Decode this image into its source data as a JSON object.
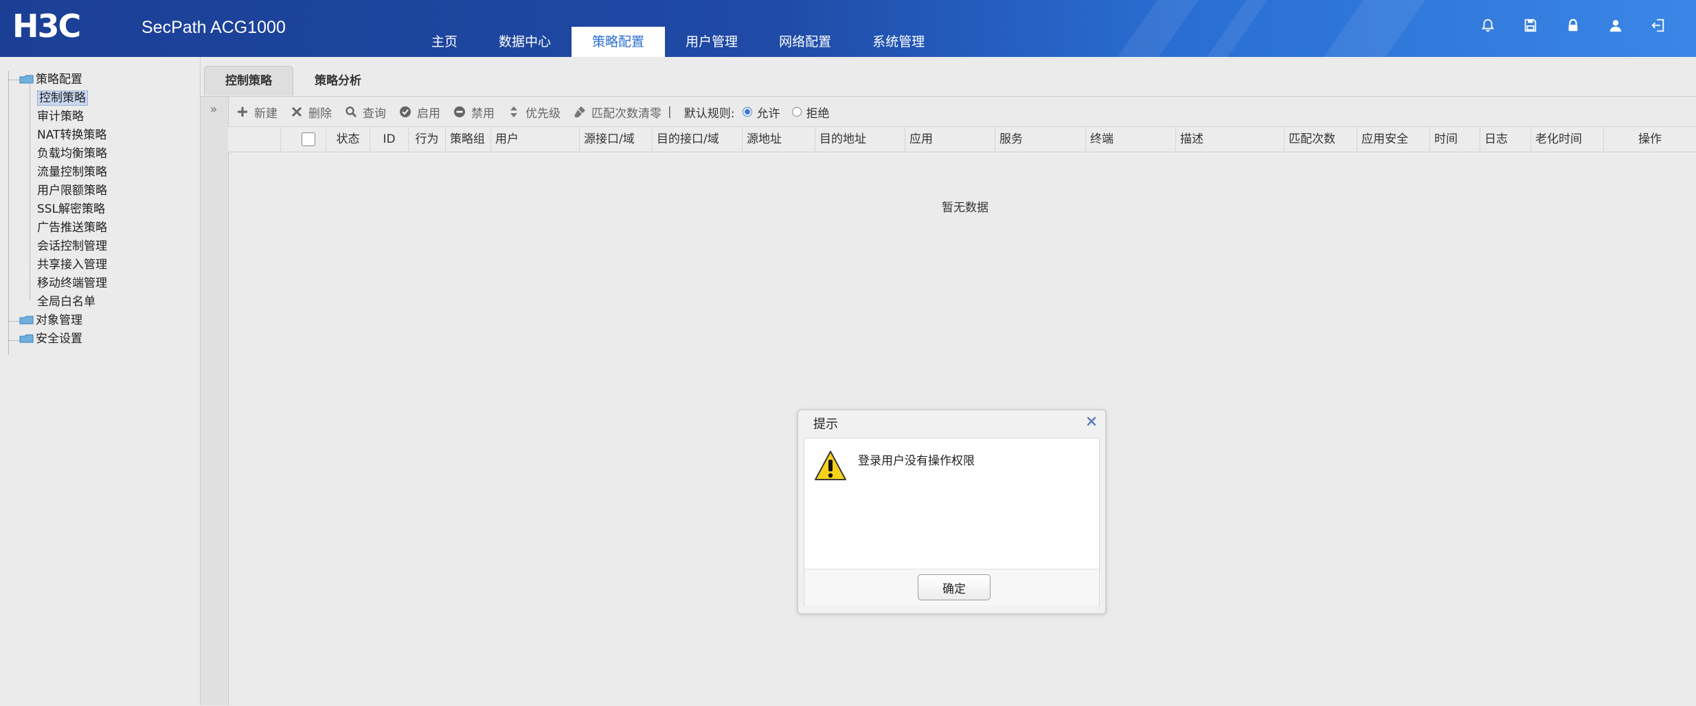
{
  "header": {
    "logo_text": "H3C",
    "product": "SecPath ACG1000",
    "nav": [
      {
        "label": "主页",
        "active": false
      },
      {
        "label": "数据中心",
        "active": false
      },
      {
        "label": "策略配置",
        "active": true
      },
      {
        "label": "用户管理",
        "active": false
      },
      {
        "label": "网络配置",
        "active": false
      },
      {
        "label": "系统管理",
        "active": false
      }
    ],
    "icons": [
      "bell-icon",
      "save-icon",
      "lock-icon",
      "user-icon",
      "logout-icon"
    ]
  },
  "sidebar": {
    "root": "策略配置",
    "children": [
      "控制策略",
      "审计策略",
      "NAT转换策略",
      "负载均衡策略",
      "流量控制策略",
      "用户限额策略",
      "SSL解密策略",
      "广告推送策略",
      "会话控制管理",
      "共享接入管理",
      "移动终端管理",
      "全局白名单"
    ],
    "selected": "控制策略",
    "others": [
      "对象管理",
      "安全设置"
    ]
  },
  "tabs": [
    {
      "label": "控制策略",
      "active": true
    },
    {
      "label": "策略分析",
      "active": false
    }
  ],
  "toolbar": {
    "new": "新建",
    "delete": "删除",
    "query": "查询",
    "enable": "启用",
    "disable": "禁用",
    "priority": "优先级",
    "clear_count": "匹配次数清零",
    "separator": "|",
    "default_rule_label": "默认规则:",
    "allow": "允许",
    "deny": "拒绝",
    "default_rule_value": "允许"
  },
  "table": {
    "columns": [
      "状态",
      "ID",
      "行为",
      "策略组",
      "用户",
      "源接口/域",
      "目的接口/域",
      "源地址",
      "目的地址",
      "应用",
      "服务",
      "终端",
      "描述",
      "匹配次数",
      "应用安全",
      "时间",
      "日志",
      "老化时间",
      "操作"
    ],
    "empty_text": "暂无数据"
  },
  "dialog": {
    "title": "提示",
    "message": "登录用户没有操作权限",
    "ok": "确定"
  },
  "colors": {
    "header_start": "#1b3f95",
    "header_end": "#3a86e6",
    "active_nav_text": "#2a6fd1",
    "radio_checked": "#3c78d8"
  }
}
